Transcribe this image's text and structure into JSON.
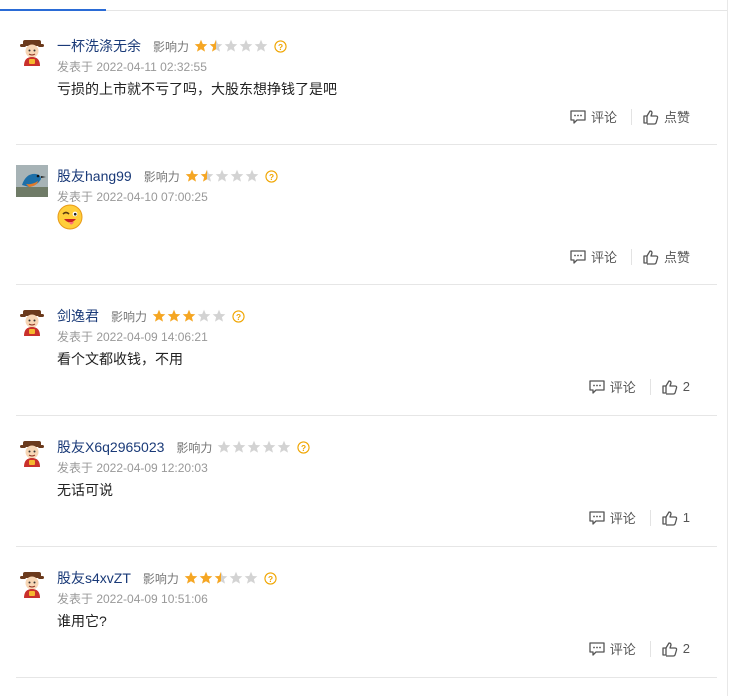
{
  "ui": {
    "accent": "#2a6bd6",
    "star_on": "#f5a623",
    "star_off": "#d3d3d3"
  },
  "comments": [
    {
      "name": "一杯洗涤无余",
      "influence_label": "影响力",
      "rating": 1.5,
      "date": "发表于 2022-04-11 02:32:55",
      "text": "亏损的上市就不亏了吗，大股东想挣钱了是吧",
      "comment_label": "评论",
      "like_label": "点赞",
      "avatar": "caishen-avatar-icon"
    },
    {
      "name": "股友hang99",
      "influence_label": "影响力",
      "rating": 1.5,
      "date": "发表于 2022-04-10 07:00:25",
      "text": "",
      "emoji": "wink-tongue-emoji-icon",
      "comment_label": "评论",
      "like_label": "点赞",
      "avatar": "bird-photo-avatar-icon"
    },
    {
      "name": "剑逸君",
      "influence_label": "影响力",
      "rating": 3,
      "date": "发表于 2022-04-09 14:06:21",
      "text": "看个文都收钱，不用",
      "comment_label": "评论",
      "like_label": "2",
      "avatar": "caishen-avatar-icon"
    },
    {
      "name": "股友X6q2965023",
      "influence_label": "影响力",
      "rating": 0,
      "date": "发表于 2022-04-09 12:20:03",
      "text": "无话可说",
      "comment_label": "评论",
      "like_label": "1",
      "avatar": "caishen-avatar-icon"
    },
    {
      "name": "股友s4xvZT",
      "influence_label": "影响力",
      "rating": 2.5,
      "date": "发表于 2022-04-09 10:51:06",
      "text": "谁用它?",
      "comment_label": "评论",
      "like_label": "2",
      "avatar": "caishen-avatar-icon"
    }
  ]
}
